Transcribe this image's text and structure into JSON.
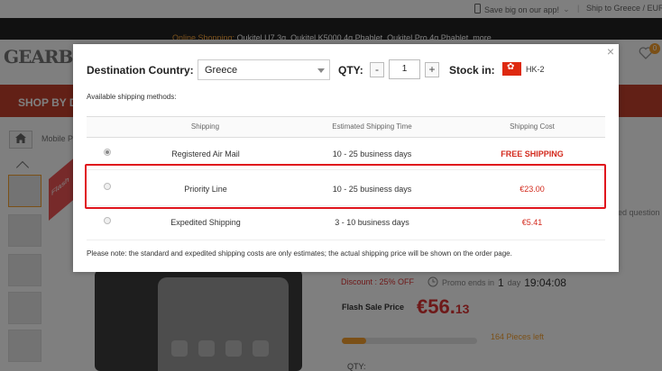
{
  "topbar": {
    "app_text": "Save big on our app!",
    "ship_text": "Ship to Greece / EUR"
  },
  "promo_strip": {
    "label": "Online Shopping:",
    "items": "Oukitel U7 3g,  Oukitel K5000 4g Phablet,  Oukitel Pro 4g Phablet,  more"
  },
  "header": {
    "logo": "GEARBEST",
    "cart_count": "0"
  },
  "navbar": {
    "shop_by": "SHOP BY DE"
  },
  "breadcrumb": {
    "text": "Mobile P"
  },
  "product": {
    "ribbon": "Flash",
    "discount": "Discount : 25% OFF",
    "promo_ends_label": "Promo ends in",
    "promo_days": "1",
    "promo_days_unit": "day",
    "promo_time": "19:04:08",
    "flash_label": "Flash Sale Price",
    "price_main": "€56.",
    "price_cents": "13",
    "pieces_left": "164 Pieces left",
    "sold_fraction": 0.18,
    "side_question": "red question",
    "qty_label": "QTY:"
  },
  "modal": {
    "close_glyph": "×",
    "destination_label": "Destination Country:",
    "destination_value": "Greece",
    "qty_label": "QTY:",
    "qty_minus": "-",
    "qty_value": "1",
    "qty_plus": "+",
    "stock_label": "Stock in:",
    "warehouse": "HK-2",
    "available_label": "Available shipping methods:",
    "columns": [
      "Shipping",
      "Estimated Shipping Time",
      "Shipping Cost"
    ],
    "rows": [
      {
        "method": "Registered Air Mail",
        "time": "10 - 25 business days",
        "cost": "FREE SHIPPING",
        "selected": true
      },
      {
        "method": "Priority Line",
        "time": "10 - 25 business days",
        "cost": "€23.00",
        "selected": false
      },
      {
        "method": "Expedited Shipping",
        "time": "3 - 10 business days",
        "cost": "€5.41",
        "selected": false
      }
    ],
    "note": "Please note: the standard and expedited shipping costs are only estimates; the actual shipping price will be shown on the order page."
  },
  "colors": {
    "brand_red": "#c4402c",
    "price_red": "#d32a1d",
    "highlight_red": "#e0141d",
    "accent_orange": "#f7a02e"
  }
}
